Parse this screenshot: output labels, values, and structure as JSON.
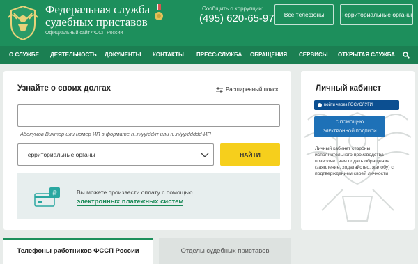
{
  "header": {
    "title_line1": "Федеральная служба",
    "title_line2": "судебных приставов",
    "subtitle": "Официальный сайт ФССП России",
    "corruption_label": "Сообщить о коррупции:",
    "corruption_phone": "(495) 620-65-97",
    "btn_all_phones": "Все телефоны",
    "btn_regions": "Территориальные органы",
    "colors": {
      "header_bg": "#1d8f5c",
      "nav_bg": "#1b7f52"
    }
  },
  "nav": {
    "items": [
      "О СЛУЖБЕ",
      "ДЕЯТЕЛЬНОСТЬ",
      "ДОКУМЕНТЫ",
      "КОНТАКТЫ",
      "ПРЕСС-СЛУЖБА",
      "ОБРАЩЕНИЯ",
      "СЕРВИСЫ",
      "ОТКРЫТАЯ СЛУЖБА"
    ],
    "search_icon": "search-icon"
  },
  "debt_search": {
    "title": "Узнайте о своих долгах",
    "advanced_label": "Расширенный поиск",
    "input_value": "",
    "hint": "Абокумов Виктор или номер ИП в формате n..n/yy/dd/rr или n..n/yy/ddddd-ИП",
    "region_selected": "Территориальные органы",
    "find_button": "НАЙТИ",
    "accent_color": "#f6cf1c"
  },
  "payment": {
    "text": "Вы можете произвести оплату с помощью",
    "link": "электронных платежных систем"
  },
  "cabinet": {
    "title": "Личный кабинет",
    "gosuslugi_button": "войти через ГОСУСЛУГИ",
    "esign_line1": "С ПОМОЩЬЮ",
    "esign_line2": "ЭЛЕКТРОННОЙ ПОДПИСИ",
    "description": "Личный кабинет стороны исполнительного производства позволяет вам подать обращение (заявление, ходатайство, жалобу) с подтверждением своей личности"
  },
  "tabs": {
    "tab1": "Телефоны работников ФССП России",
    "tab2": "Отделы судебных приставов"
  }
}
